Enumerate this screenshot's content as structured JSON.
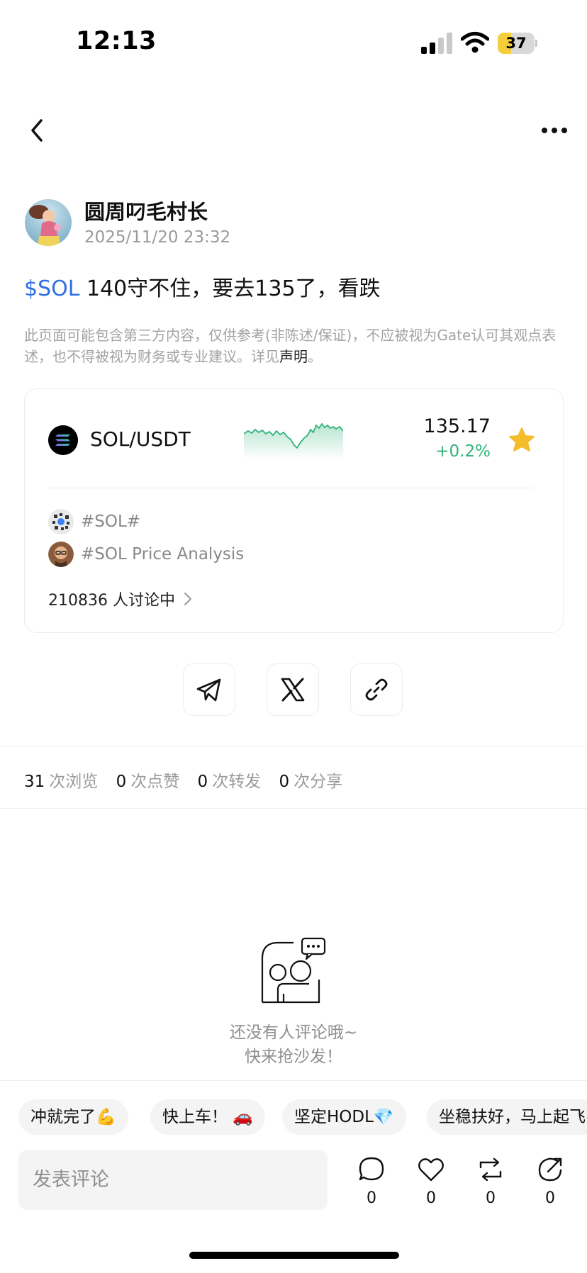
{
  "status_bar": {
    "time": "12:13",
    "battery": "37",
    "battery_level": 0.37
  },
  "author": {
    "name": "圆周叼毛村长",
    "date": "2025/11/20 23:32"
  },
  "post": {
    "ticker": "$SOL",
    "text": " 140守不住，要去135了，看跌"
  },
  "disclaimer": {
    "text": "此页面可能包含第三方内容，仅供参考(非陈述/保证)，不应被视为Gate认可其观点表述，也不得被视为财务或专业建议。详见",
    "link": "声明",
    "end": "。"
  },
  "market": {
    "pair": "SOL/USDT",
    "price": "135.17",
    "change": "+0.2%",
    "change_color": "#2fb37a"
  },
  "topics": [
    {
      "label": "#SOL#"
    },
    {
      "label": "#SOL Price Analysis"
    }
  ],
  "discussion": {
    "count": "210836",
    "label": " 人讨论中"
  },
  "stats": [
    {
      "num": "31",
      "label": "次浏览"
    },
    {
      "num": "0",
      "label": "次点赞"
    },
    {
      "num": "0",
      "label": "次转发"
    },
    {
      "num": "0",
      "label": "次分享"
    }
  ],
  "empty": {
    "line1": "还没有人评论哦~",
    "line2": "快来抢沙发！"
  },
  "quick_replies": [
    {
      "text": "冲就完了💪"
    },
    {
      "text": "快上车！ 🚗"
    },
    {
      "text": "坚定HODL💎"
    },
    {
      "text": "坐稳扶好，马上起飞🚀"
    }
  ],
  "comment": {
    "placeholder": "发表评论"
  },
  "actions": [
    {
      "name": "comment-icon",
      "count": "0"
    },
    {
      "name": "like-icon",
      "count": "0"
    },
    {
      "name": "repost-icon",
      "count": "0"
    },
    {
      "name": "share-icon",
      "count": "0"
    }
  ],
  "accent_color": "#2f6fe4"
}
